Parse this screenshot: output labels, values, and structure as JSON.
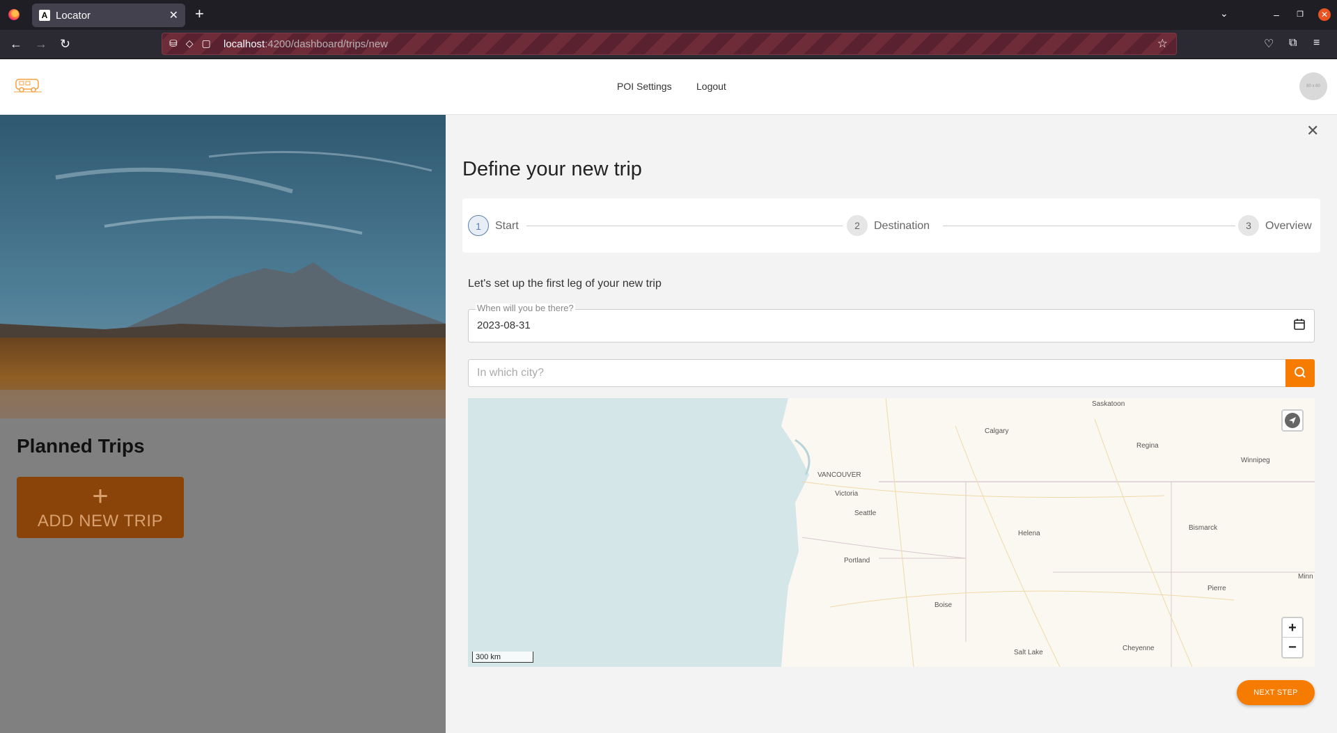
{
  "browser": {
    "tab_title": "Locator",
    "url_host": "localhost",
    "url_path": ":4200/dashboard/trips/new"
  },
  "header": {
    "nav": [
      "POI Settings",
      "Logout"
    ],
    "avatar_text": "80 x 80"
  },
  "left_panel": {
    "title": "Planned Trips",
    "add_button_label": "ADD NEW TRIP"
  },
  "form": {
    "title": "Define your new trip",
    "steps": [
      {
        "number": "1",
        "label": "Start"
      },
      {
        "number": "2",
        "label": "Destination"
      },
      {
        "number": "3",
        "label": "Overview"
      }
    ],
    "active_step": 1,
    "subtitle": "Let's set up the first leg of your new trip",
    "date_label": "When will you be there?",
    "date_value": "2023-08-31",
    "city_placeholder": "In which city?",
    "next_label": "NEXT STEP"
  },
  "map": {
    "scale_label": "300 km",
    "zoom_in": "+",
    "zoom_out": "−",
    "cities": [
      "Saskatoon",
      "Calgary",
      "Regina",
      "Winnipeg",
      "VANCOUVER",
      "Victoria",
      "Seattle",
      "Helena",
      "Bismarck",
      "Portland",
      "Pierre",
      "Minn",
      "Boise",
      "Salt Lake",
      "Cheyenne"
    ]
  },
  "colors": {
    "accent": "#f57c00",
    "add_button": "#8a4308"
  }
}
